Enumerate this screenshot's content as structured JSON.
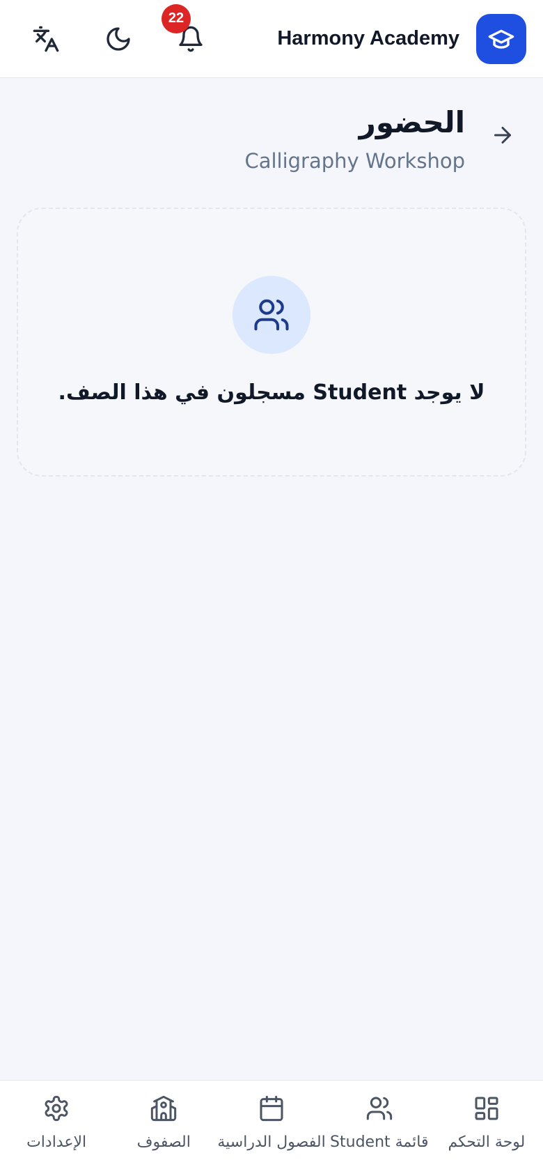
{
  "header": {
    "app_name": "Harmony Academy",
    "notification_count": "22",
    "icons": {
      "logo": "graduation-cap-icon",
      "notifications": "bell-icon",
      "theme": "moon-icon",
      "language": "translate-icon"
    }
  },
  "page": {
    "title": "الحضور",
    "subtitle": "Calligraphy Workshop",
    "back_icon": "arrow-right-icon"
  },
  "empty_state": {
    "icon": "users-icon",
    "message": "لا يوجد Student مسجلون في هذا الصف."
  },
  "bottom_nav": {
    "items": [
      {
        "label": "لوحة التحكم",
        "icon": "dashboard-icon"
      },
      {
        "label": "قائمة Student",
        "icon": "users-icon"
      },
      {
        "label": "الفصول الدراسية",
        "icon": "calendar-icon"
      },
      {
        "label": "الصفوف",
        "icon": "building-icon"
      },
      {
        "label": "الإعدادات",
        "icon": "gear-icon"
      }
    ]
  },
  "colors": {
    "brand": "#1f4fe0",
    "badge": "#dc2626",
    "background": "#f4f6fb",
    "empty_icon_bg": "#dbe8fd"
  }
}
